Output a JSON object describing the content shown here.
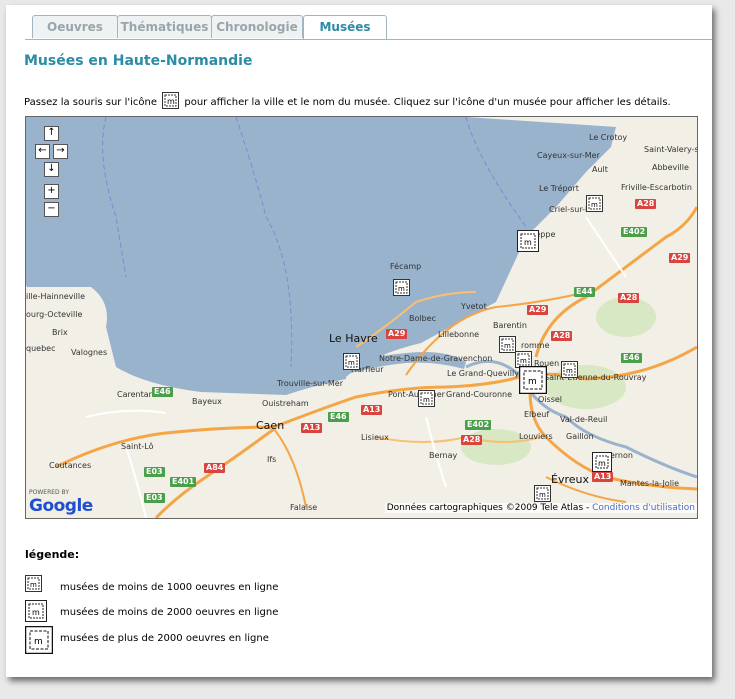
{
  "tabs": [
    "Oeuvres",
    "Thématiques",
    "Chronologie",
    "Musées"
  ],
  "page_title": "Musées en Haute-Normandie",
  "intro": {
    "before": "Passez la souris sur l'icône",
    "after": "pour afficher la ville et le nom du musée. Cliquez sur l'icône d'un musée pour afficher les détails."
  },
  "map": {
    "controls": {
      "up": "↑",
      "left": "←",
      "right": "→",
      "down": "↓",
      "zoom_in": "+",
      "zoom_out": "−"
    },
    "places": {
      "crotoy": "Le Crotoy",
      "valery": "Saint-Valery-s",
      "cayeux": "Cayeux-sur-Mer",
      "abbeville": "Abbeville",
      "ault": "Ault",
      "treport": "Le Tréport",
      "friville": "Friville-Escarbotin",
      "criel": "Criel-sur-Mer",
      "dieppe": "Dieppe",
      "fecamp": "Fécamp",
      "hainneville": "ille-Hainneville",
      "octeville": "ourg-Octeville",
      "brix": "Brix",
      "quebec": "quebec",
      "valognes": "Valognes",
      "yvetot": "Yvetot",
      "bolbec": "Bolbec",
      "lillebonne": "Lillebonne",
      "barentin": "Barentin",
      "lehavre": "Le Havre",
      "harfleur": "Harfleur",
      "notredame": "Notre-Dame-de-Gravenchon",
      "bromme": "romme",
      "rouen": "Rouen",
      "quevilly": "Le Grand-Quevilly",
      "etienne": "Saint-Étienne-du-Rouvray",
      "carentan": "Carentan",
      "bayeux": "Bayeux",
      "trouville": "Trouville-sur-Mer",
      "pontaudemer": "Pont-Audemer",
      "couronne": "Grand-Couronne",
      "oissel": "Oissel",
      "ouistreham": "Ouistreham",
      "caen": "Caen",
      "lisieux": "Lisieux",
      "elbeuf": "Elbeuf",
      "valdereuil": "Val-de-Reuil",
      "stlo": "Saint-Lô",
      "louviers": "Louviers",
      "gaillon": "Gaillon",
      "coutances": "Coutances",
      "ifs": "Ifs",
      "bernay": "Bernay",
      "vernon": "Vernon",
      "evreux": "Évreux",
      "mantes": "Mantes-la-Jolie",
      "falaise": "Falaise"
    },
    "roads": {
      "a28a": "A28",
      "a29a": "A29",
      "a29b": "A29",
      "e402a": "E402",
      "e44": "E44",
      "a28b": "A28",
      "a29c": "A29",
      "a28c": "A28",
      "e46a": "E46",
      "e46b": "E46",
      "a13a": "A13",
      "a13b": "A13",
      "e402b": "E402",
      "a28d": "A28",
      "e03a": "E03",
      "a84": "A84",
      "e401": "E401",
      "e03b": "E03",
      "a13c": "A13"
    },
    "logo": {
      "powered": "POWERED BY",
      "name": "Google"
    },
    "copyright": "Données cartographiques ©2009 Tele Atlas -",
    "terms_link": "Conditions d'utilisation"
  },
  "legend": {
    "title": "légende:",
    "items": [
      "musées de moins de 1000 oeuvres en ligne",
      "musées de moins de 2000 oeuvres en ligne",
      "musées de plus de 2000 oeuvres en ligne"
    ]
  },
  "icon_names": {
    "museum": "museum-icon"
  },
  "colors": {
    "accent": "#2a8ca5",
    "sea": "#99b3cc",
    "land": "#f2efe6",
    "autoroute": "#d9443f",
    "europe": "#4aa04a"
  }
}
